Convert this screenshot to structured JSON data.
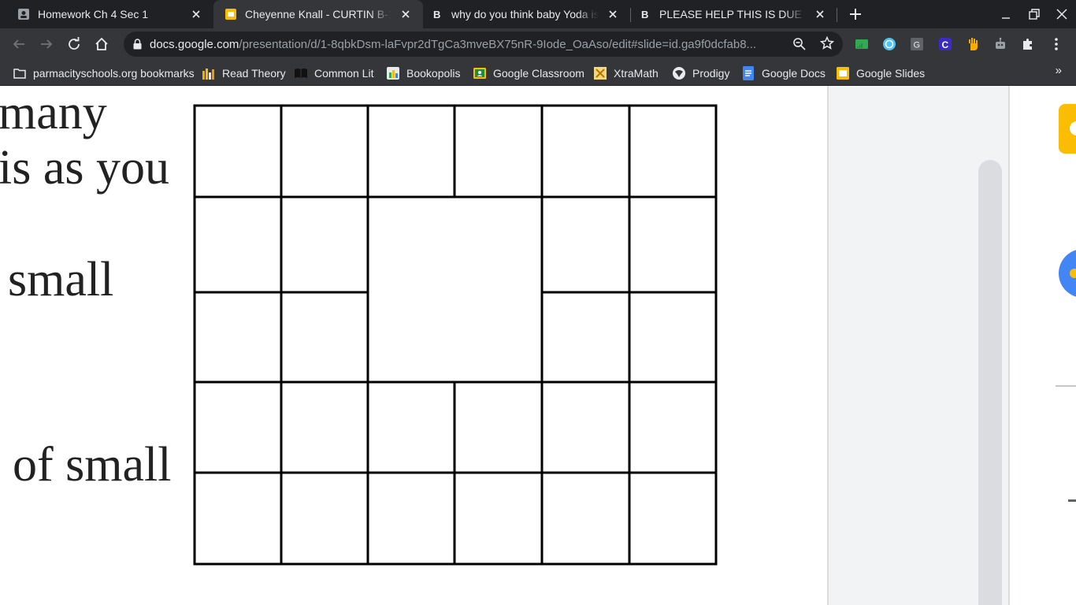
{
  "tabs": [
    {
      "title": "Homework Ch 4 Sec 1",
      "icon": "classroom-assignment-icon",
      "active": false
    },
    {
      "title": "Cheyenne Knall - CURTIN B-1/B-2",
      "icon": "google-slides-icon",
      "active": true
    },
    {
      "title": "why do you think baby Yoda is awesome",
      "icon": "brainly-icon",
      "active": false
    },
    {
      "title": "PLEASE HELP THIS IS DUE TODAY",
      "icon": "brainly-icon",
      "active": false
    }
  ],
  "toolbar": {
    "url_host": "docs.google.com",
    "url_path": "/presentation/d/1-8qbkDsm-laFvpr2dTgCa3mveBX75nR-9Iode_OaAso/edit#slide=id.ga9f0dcfab8..."
  },
  "bookmarks": [
    {
      "label": "parmacityschools.org bookmarks",
      "icon": "folder-icon"
    },
    {
      "label": "Read Theory",
      "icon": "read-theory-icon"
    },
    {
      "label": "Common Lit",
      "icon": "common-lit-icon"
    },
    {
      "label": "Bookopolis",
      "icon": "bookopolis-icon"
    },
    {
      "label": "Google Classroom",
      "icon": "google-classroom-icon"
    },
    {
      "label": "XtraMath",
      "icon": "xtramath-icon"
    },
    {
      "label": "Prodigy",
      "icon": "prodigy-icon"
    },
    {
      "label": "Google Docs",
      "icon": "google-docs-icon"
    },
    {
      "label": "Google Slides",
      "icon": "google-slides-icon"
    }
  ],
  "bookmarks_overflow": "»",
  "slide": {
    "text_lines": [
      "many",
      "is as you",
      "small",
      "of small"
    ]
  },
  "colors": {
    "tabstrip": "#202124",
    "toolbar": "#35363a",
    "slides_yellow": "#fbbc04",
    "docs_blue": "#4285f4"
  }
}
